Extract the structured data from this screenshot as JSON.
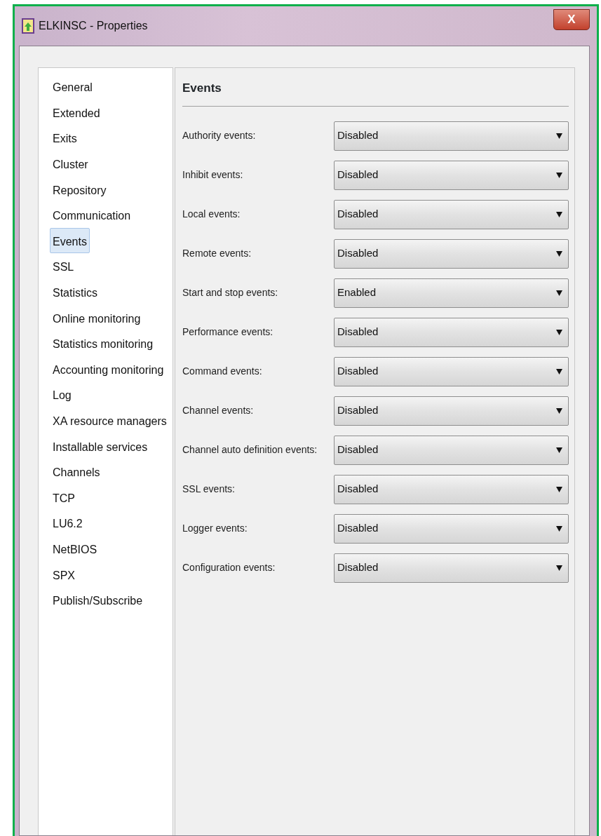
{
  "window": {
    "title": "ELKINSC - Properties",
    "close_label": "X"
  },
  "sidebar": {
    "items": [
      {
        "label": "General",
        "selected": false
      },
      {
        "label": "Extended",
        "selected": false
      },
      {
        "label": "Exits",
        "selected": false
      },
      {
        "label": "Cluster",
        "selected": false
      },
      {
        "label": "Repository",
        "selected": false
      },
      {
        "label": "Communication",
        "selected": false
      },
      {
        "label": "Events",
        "selected": true
      },
      {
        "label": "SSL",
        "selected": false
      },
      {
        "label": "Statistics",
        "selected": false
      },
      {
        "label": "Online monitoring",
        "selected": false
      },
      {
        "label": "Statistics monitoring",
        "selected": false
      },
      {
        "label": "Accounting monitoring",
        "selected": false
      },
      {
        "label": "Log",
        "selected": false
      },
      {
        "label": "XA resource managers",
        "selected": false
      },
      {
        "label": "Installable services",
        "selected": false
      },
      {
        "label": "Channels",
        "selected": false
      },
      {
        "label": "TCP",
        "selected": false
      },
      {
        "label": "LU6.2",
        "selected": false
      },
      {
        "label": "NetBIOS",
        "selected": false
      },
      {
        "label": "SPX",
        "selected": false
      },
      {
        "label": "Publish/Subscribe",
        "selected": false
      }
    ]
  },
  "panel": {
    "heading": "Events",
    "fields": [
      {
        "label": "Authority events:",
        "value": "Disabled"
      },
      {
        "label": "Inhibit events:",
        "value": "Disabled"
      },
      {
        "label": "Local events:",
        "value": "Disabled"
      },
      {
        "label": "Remote events:",
        "value": "Disabled"
      },
      {
        "label": "Start and stop events:",
        "value": "Enabled"
      },
      {
        "label": "Performance events:",
        "value": "Disabled"
      },
      {
        "label": "Command events:",
        "value": "Disabled"
      },
      {
        "label": "Channel events:",
        "value": "Disabled"
      },
      {
        "label": "Channel auto definition events:",
        "value": "Disabled"
      },
      {
        "label": "SSL events:",
        "value": "Disabled"
      },
      {
        "label": "Logger events:",
        "value": "Disabled"
      },
      {
        "label": "Configuration events:",
        "value": "Disabled"
      }
    ]
  }
}
